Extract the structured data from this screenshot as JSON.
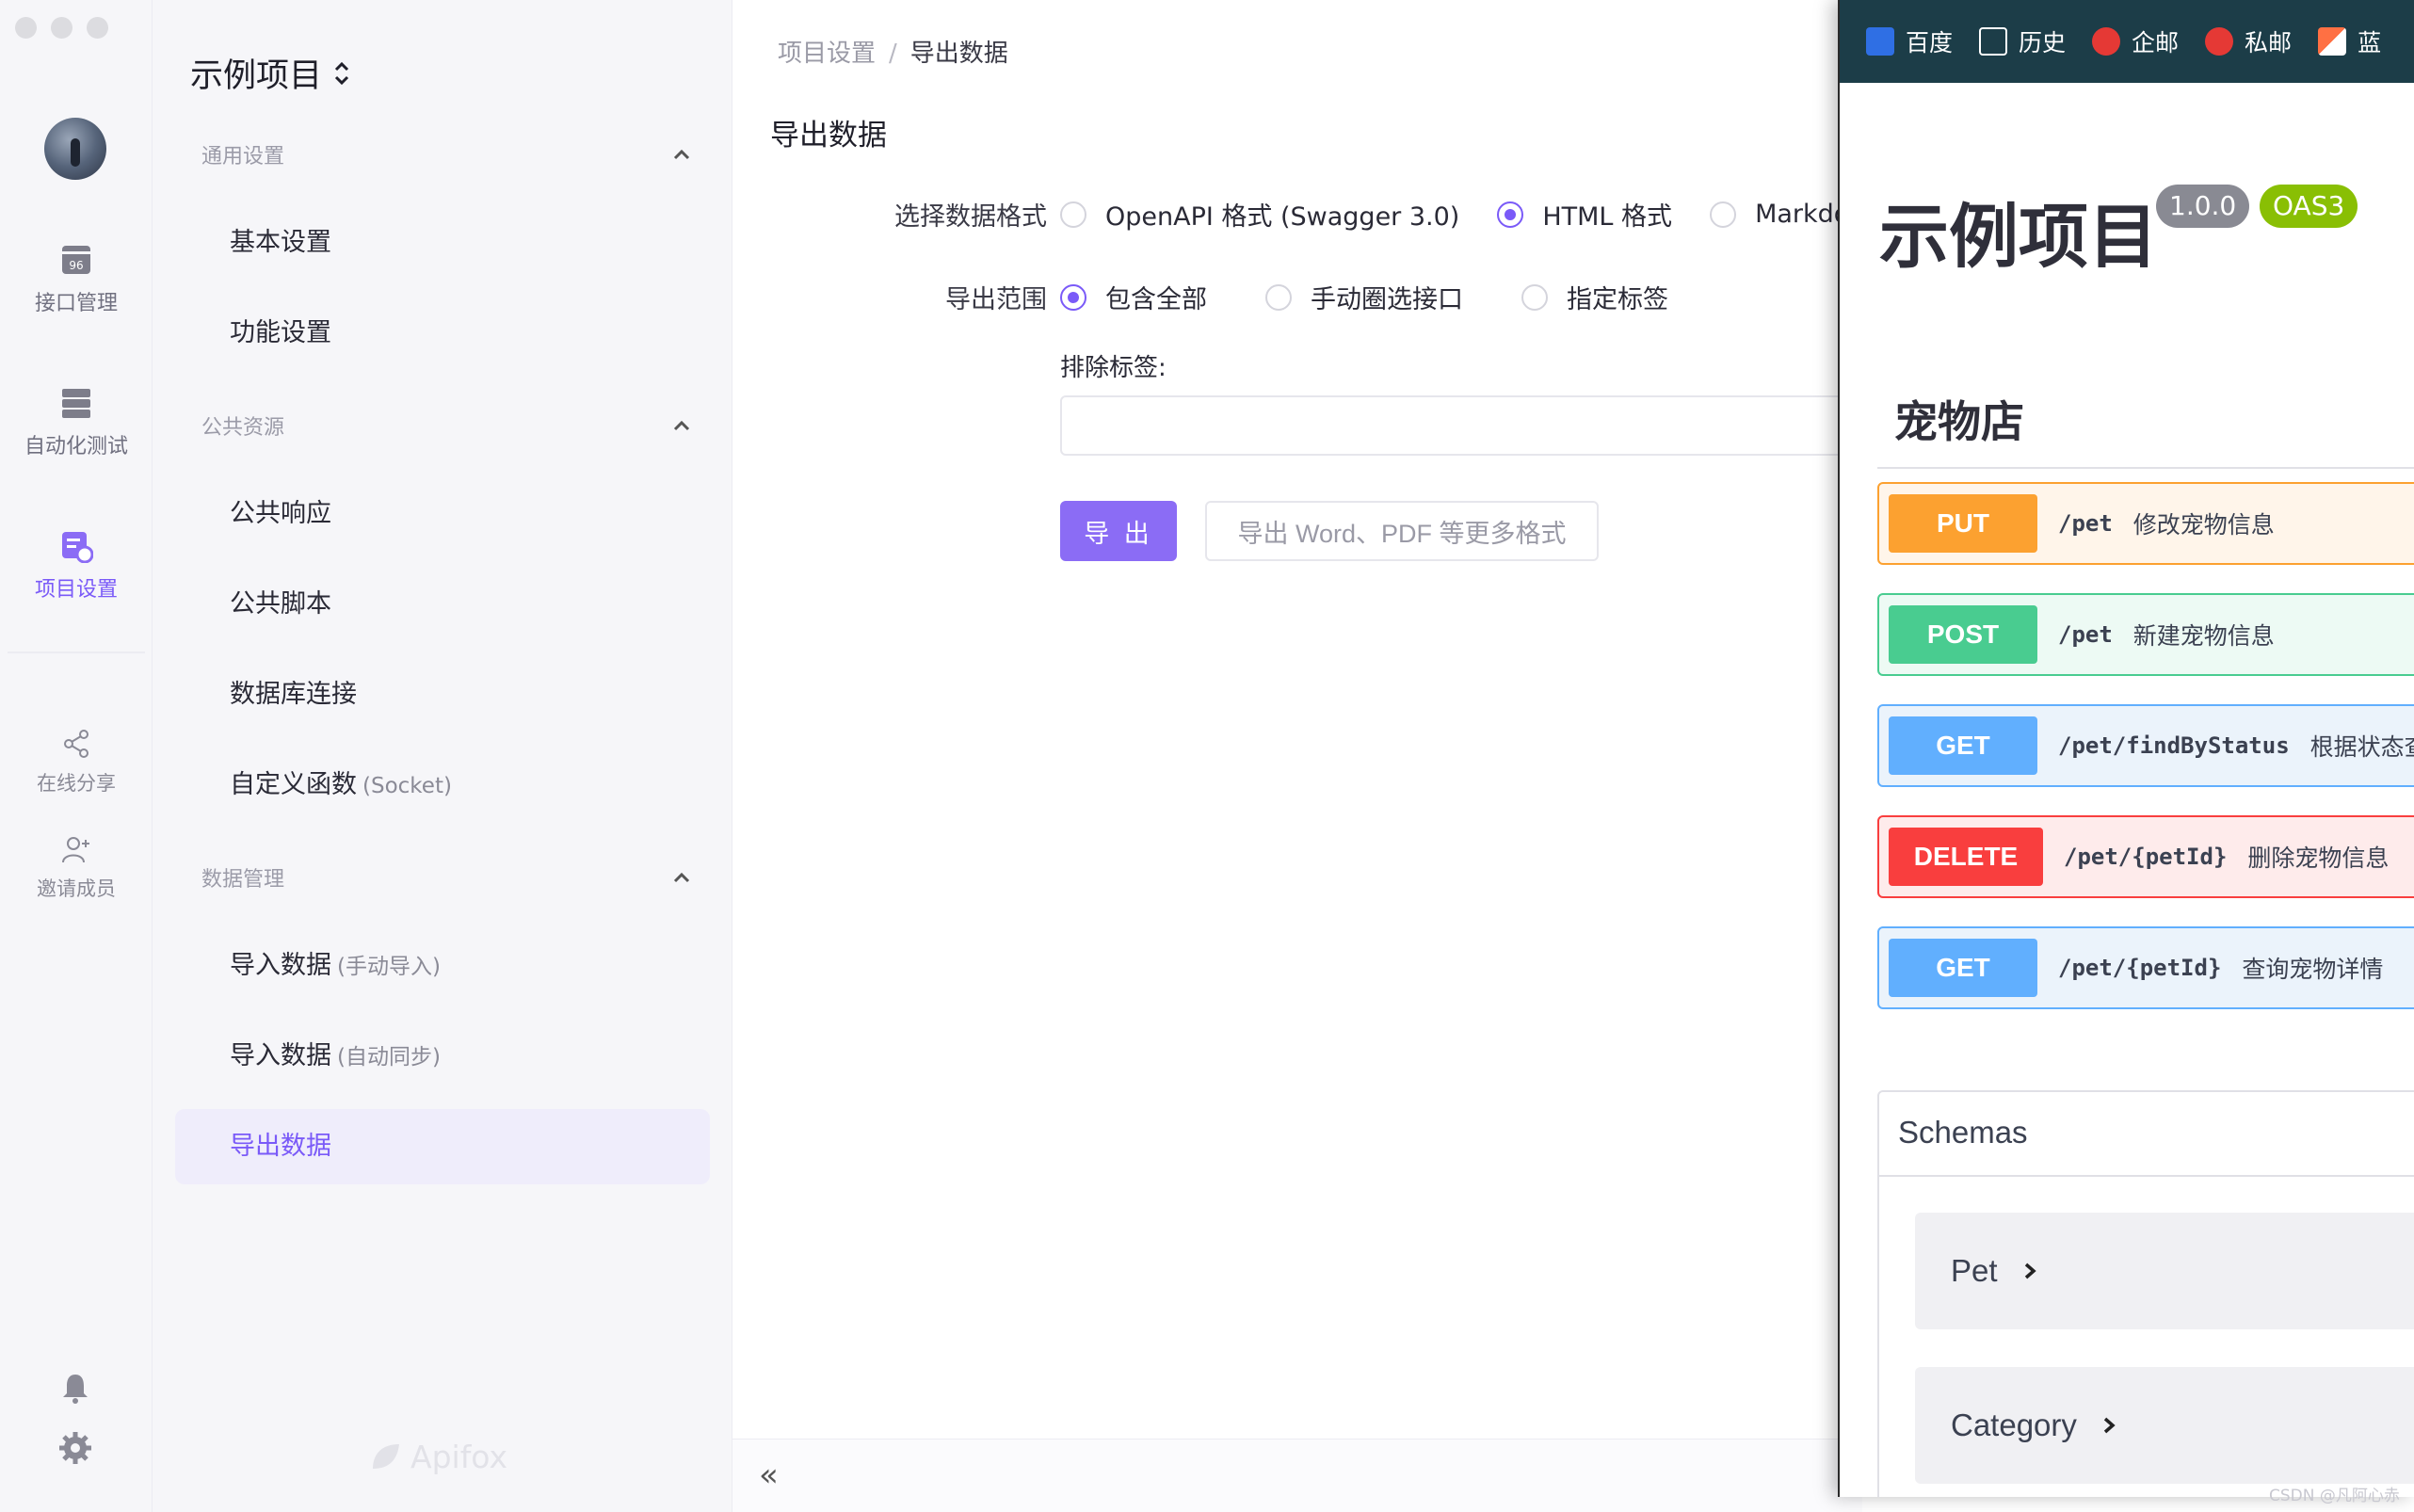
{
  "rail": {
    "items": [
      {
        "label": "接口管理",
        "icon": "api-management-icon"
      },
      {
        "label": "自动化测试",
        "icon": "automation-test-icon"
      },
      {
        "label": "项目设置",
        "icon": "project-settings-icon"
      },
      {
        "label": "在线分享",
        "icon": "share-icon"
      },
      {
        "label": "邀请成员",
        "icon": "invite-member-icon"
      }
    ],
    "active": "项目设置",
    "bottom_icons": [
      "bell-icon",
      "gear-icon"
    ]
  },
  "sidebar": {
    "project_title": "示例项目",
    "sections": [
      {
        "title": "通用设置",
        "items": [
          {
            "label": "基本设置"
          },
          {
            "label": "功能设置"
          }
        ]
      },
      {
        "title": "公共资源",
        "items": [
          {
            "label": "公共响应"
          },
          {
            "label": "公共脚本"
          },
          {
            "label": "数据库连接"
          },
          {
            "label": "自定义函数",
            "note": "(Socket)"
          }
        ]
      },
      {
        "title": "数据管理",
        "items": [
          {
            "label": "导入数据",
            "note": "(手动导入)"
          },
          {
            "label": "导入数据",
            "note": "(自动同步)"
          },
          {
            "label": "导出数据",
            "active": true
          }
        ]
      }
    ],
    "brand": "Apifox"
  },
  "main": {
    "breadcrumb": [
      "项目设置",
      "/",
      "导出数据"
    ],
    "title": "导出数据",
    "format_label": "选择数据格式",
    "format_options": [
      "OpenAPI 格式 (Swagger 3.0)",
      "HTML 格式",
      "Markdow"
    ],
    "format_selected": "HTML 格式",
    "scope_label": "导出范围",
    "scope_options": [
      "包含全部",
      "手动圈选接口",
      "指定标签"
    ],
    "scope_selected": "包含全部",
    "exclude_label": "排除标签:",
    "exclude_value": "",
    "export_button": "导 出",
    "more_formats_button": "导出 Word、PDF 等更多格式",
    "collapse_icon": "double-chevron-left-icon"
  },
  "browser": {
    "bookmarks": [
      "百度",
      "历史",
      "企邮",
      "私邮",
      "蓝"
    ],
    "doc_title": "示例项目",
    "version_badge": "1.0.0",
    "oas_badge": "OAS3",
    "tag": "宠物店",
    "operations": [
      {
        "method": "PUT",
        "path": "/pet",
        "summary": "修改宠物信息"
      },
      {
        "method": "POST",
        "path": "/pet",
        "summary": "新建宠物信息"
      },
      {
        "method": "GET",
        "path": "/pet/findByStatus",
        "summary": "根据状态查"
      },
      {
        "method": "DELETE",
        "path": "/pet/{petId}",
        "summary": "删除宠物信息"
      },
      {
        "method": "GET",
        "path": "/pet/{petId}",
        "summary": "查询宠物详情"
      }
    ],
    "schemas_title": "Schemas",
    "schemas": [
      "Pet",
      "Category"
    ]
  },
  "watermark": "CSDN @凡阿心赤",
  "colors": {
    "accent": "#7a5af8",
    "put": "#fca130",
    "post": "#49cc90",
    "get": "#61affe",
    "delete": "#f93e3e"
  }
}
